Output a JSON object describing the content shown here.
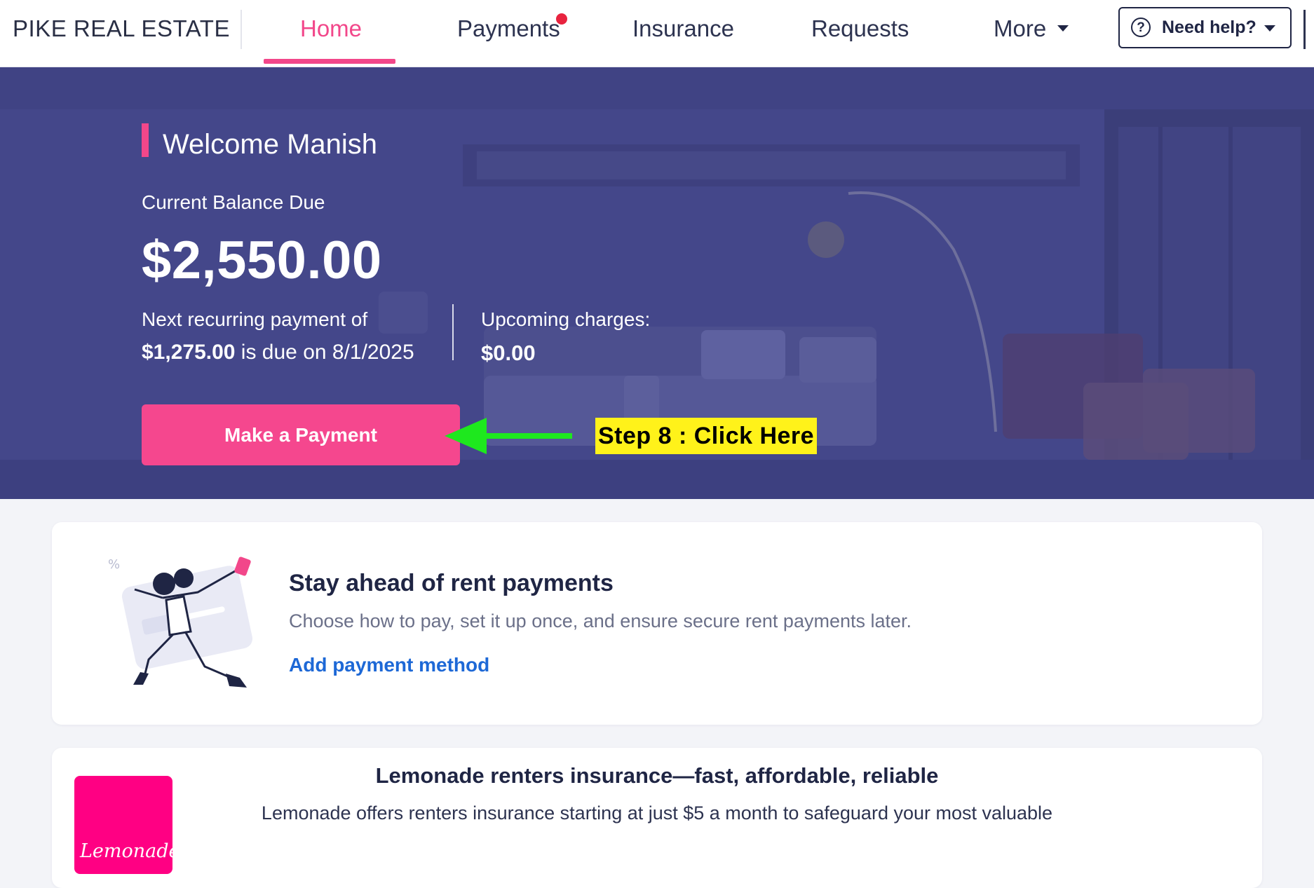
{
  "brand": "PIKE REAL ESTATE",
  "nav": {
    "home": "Home",
    "payments": "Payments",
    "insurance": "Insurance",
    "requests": "Requests",
    "more": "More",
    "help": "Need help?"
  },
  "hero": {
    "welcome": "Welcome Manish",
    "balance_label": "Current Balance Due",
    "balance_amount": "$2,550.00",
    "next_line1": "Next recurring payment of",
    "next_amount": "$1,275.00",
    "next_suffix": " is due on 8/1/2025",
    "upcoming_label": "Upcoming charges:",
    "upcoming_amount": "$0.00",
    "pay_button": "Make a Payment"
  },
  "annotation": {
    "step_label": "Step 8 : Click Here"
  },
  "card_payment": {
    "title": "Stay ahead of rent payments",
    "description": "Choose how to pay, set it up once, and ensure secure rent payments later.",
    "link": "Add payment method"
  },
  "card_insurance": {
    "logo_text": "Lemonade",
    "title": "Lemonade renters insurance—fast, affordable, reliable",
    "description": "Lemonade offers renters insurance starting at just $5 a month to safeguard your most valuable"
  },
  "colors": {
    "accent_pink": "#f2478a",
    "hero_overlay": "#3f4384",
    "link_blue": "#1d68d6",
    "annotation_green": "#1ee81e",
    "annotation_yellow": "#fff21a",
    "lemonade_pink": "#ff0083"
  },
  "icons": [
    "help-circle-icon",
    "caret-down-icon",
    "notification-dot"
  ]
}
